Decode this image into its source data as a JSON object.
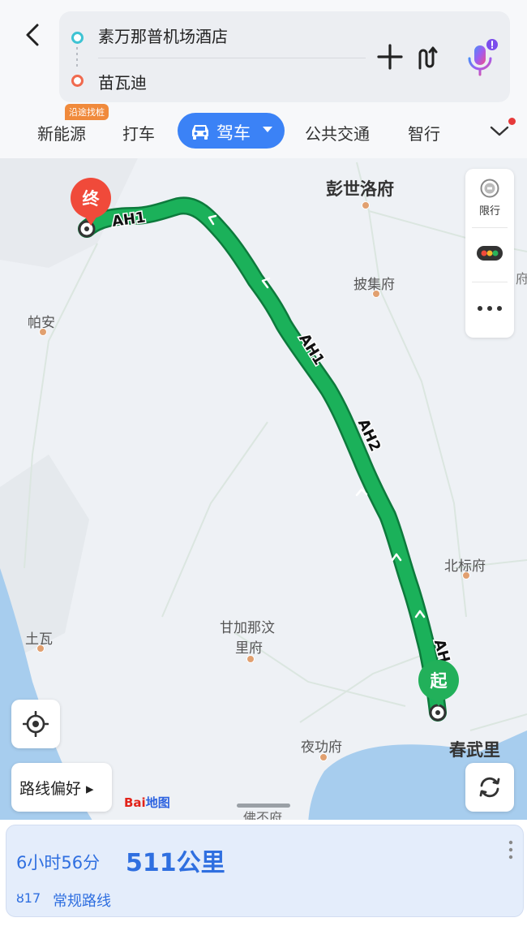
{
  "header": {
    "origin": "素万那普机场酒店",
    "destination": "苗瓦迪",
    "colors": {
      "origin_dot": "#3ec3d3",
      "destination_dot": "#f06a4f"
    }
  },
  "modes": {
    "tag": "沿途找桩",
    "items": [
      "新能源",
      "打车",
      "驾车",
      "公共交通",
      "智行"
    ],
    "selected": "驾车",
    "accent": "#3b82f6"
  },
  "map": {
    "cities": [
      {
        "name": "彭世洛府",
        "major": true
      },
      {
        "name": "披集府",
        "major": false
      },
      {
        "name": "帕安",
        "major": false
      },
      {
        "name": "北标府",
        "major": false
      },
      {
        "name": "土瓦",
        "major": false
      },
      {
        "name": "甘加那汶",
        "line2": "里府",
        "major": false
      },
      {
        "name": "夜功府",
        "major": false
      },
      {
        "name": "春武里",
        "major": true
      },
      {
        "name": "佛丕府",
        "major": false
      }
    ],
    "road_labels": [
      "AH1",
      "AH1",
      "AH2",
      "AH"
    ],
    "start_marker": "起",
    "end_marker": "终",
    "route_color": "#1bb15a",
    "right_edge_peek": "府",
    "logo": "Bai地图"
  },
  "side_panel": {
    "limit_label": "限行"
  },
  "preference_button": "路线偏好 ▸",
  "summary": {
    "duration": "6小时56分",
    "distance": "511公里",
    "traffic_lights": "ȣ17",
    "route_type": "常规路线"
  }
}
